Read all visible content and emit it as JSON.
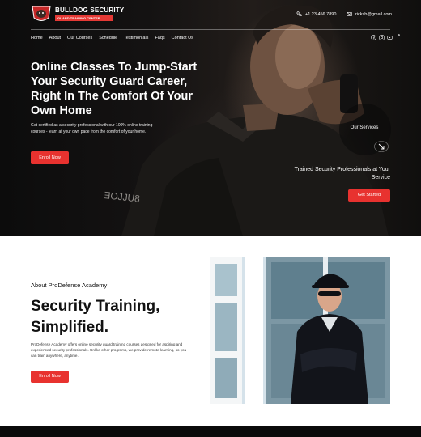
{
  "brand": {
    "title": "BULLDOG SECURITY",
    "subtitle": "GUARD TRAINING CENTER"
  },
  "contact": {
    "phone": "+1 23 456 7890",
    "email": "ricksb@gmail.com"
  },
  "nav": {
    "items": [
      "Home",
      "About",
      "Our Courses",
      "Schedule",
      "Testimonials",
      "Faqs",
      "Contact Us"
    ]
  },
  "hero": {
    "heading": "Online Classes To Jump-Start Your Security Guard Career, Right In The Comfort Of Your Own Home",
    "body": "Get certified as a security professional with our 100% online training courses - learn at your own pace from the comfort of your home.",
    "cta": "Enroll Now",
    "services_label": "Our Services",
    "side_text": "Trained Security Professionals at Your Service",
    "side_cta": "Get Started"
  },
  "about": {
    "kicker": "About ProDefense Academy",
    "heading": "Security Training, Simplified.",
    "body": "ProDefense Academy offers online security guard training courses designed for aspiring and experienced security professionals. Unlike other programs, we provide remote learning, so you can train anywhere, anytime.",
    "cta": "Enroll Now"
  },
  "colors": {
    "accent": "#e8322f",
    "hero_bg": "#141212",
    "text_dark": "#111111"
  },
  "icons": {
    "phone": "phone-icon",
    "email": "email-icon",
    "socials": [
      "facebook-icon",
      "instagram-icon",
      "youtube-icon"
    ],
    "arrow": "arrow-down-right-icon"
  }
}
